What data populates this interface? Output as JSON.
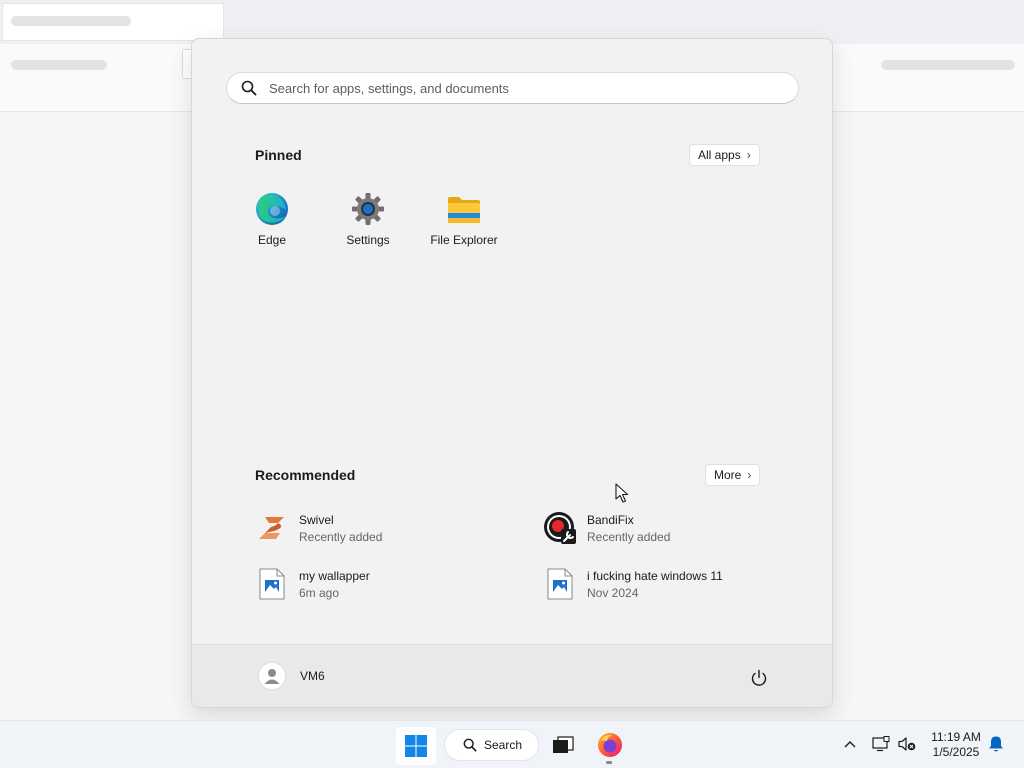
{
  "start_menu": {
    "search": {
      "placeholder": "Search for apps, settings, and documents"
    },
    "pinned": {
      "title": "Pinned",
      "all_apps_label": "All apps",
      "apps": [
        {
          "label": "Edge",
          "icon": "edge-icon"
        },
        {
          "label": "Settings",
          "icon": "settings-gear-icon"
        },
        {
          "label": "File Explorer",
          "icon": "folder-icon"
        }
      ]
    },
    "recommended": {
      "title": "Recommended",
      "more_label": "More",
      "items": [
        {
          "title": "Swivel",
          "subtitle": "Recently added",
          "icon": "swivel-app-icon"
        },
        {
          "title": "BandiFix",
          "subtitle": "Recently added",
          "icon": "bandifix-app-icon"
        },
        {
          "title": "my wallapper",
          "subtitle": "6m ago",
          "icon": "image-file-icon"
        },
        {
          "title": "i fucking hate windows 11",
          "subtitle": "Nov 2024",
          "icon": "image-file-icon"
        }
      ]
    },
    "user": {
      "name": "VM6",
      "icon": "user-avatar-icon"
    },
    "power_icon": "power-icon"
  },
  "taskbar": {
    "search_label": "Search",
    "clock": {
      "time": "11:19 AM",
      "date": "1/5/2025"
    },
    "tray_icons": [
      "chevron-up-icon",
      "network-icon",
      "volume-muted-icon",
      "notification-bell-icon"
    ]
  },
  "colors": {
    "accent": "#0067c0",
    "start_menu_bg": "#f2f2f2",
    "taskbar_bg": "#f0f3f8"
  }
}
